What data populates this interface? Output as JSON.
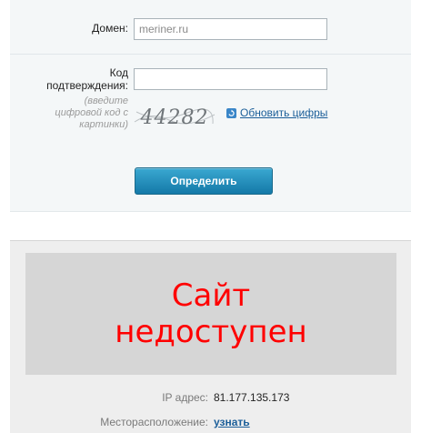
{
  "form": {
    "domain_label": "Домен:",
    "domain_value": "meriner.ru",
    "code_label_line1": "Код",
    "code_label_line2": "подтверждения:",
    "code_value": "",
    "hint_line1": "(введите",
    "hint_line2": "цифровой код с",
    "hint_line3": "картинки)",
    "captcha_text": "44282",
    "refresh_label": "Обновить цифры",
    "refresh_icon": "refresh-icon",
    "submit_label": "Определить"
  },
  "result": {
    "status_line1": "Сайт",
    "status_line2": "недоступен",
    "status_color": "#ff0000",
    "ip_label": "IP адрес:",
    "ip_value": "81.177.135.173",
    "location_label": "Месторасположение:",
    "location_link": "узнать"
  },
  "colors": {
    "accent_button": "#1479a8",
    "link": "#1b5e99"
  }
}
